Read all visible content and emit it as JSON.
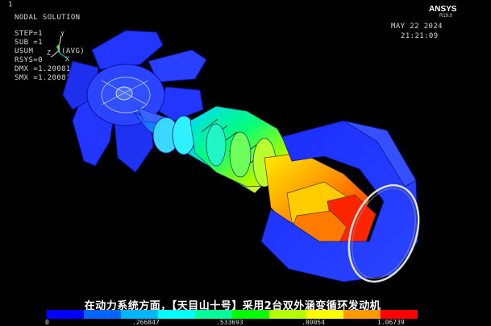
{
  "window": {
    "number": "1"
  },
  "header": {
    "title": "NODAL SOLUTION",
    "lines": [
      "STEP=1",
      "SUB =1",
      "USUM",
      "RSYS=0",
      "DMX =1.20081",
      "SMX =1.20081"
    ],
    "avg_label": "(AVG)"
  },
  "triad": {
    "y_label": "Y",
    "z_label": "Z",
    "x_label": "X"
  },
  "brand": {
    "name": "ANSYS",
    "version": "R19.0"
  },
  "timestamp": {
    "date": "MAY 22 2024",
    "time": "21:21:09"
  },
  "caption": "在动力系统方面，【天目山十号】采用2台双外涵变循环发动机",
  "legend": {
    "colors": [
      "#0000ff",
      "#0066ff",
      "#00b7ff",
      "#00ffff",
      "#00ff9a",
      "#00ff00",
      "#b4ff00",
      "#ffff00",
      "#ff9900",
      "#ff0000"
    ],
    "tick_labels": [
      "0",
      ".266847",
      ".533693",
      ".80054",
      "1.06739"
    ]
  },
  "colors": {
    "background": "#000000",
    "text": "#d7d7d7"
  }
}
